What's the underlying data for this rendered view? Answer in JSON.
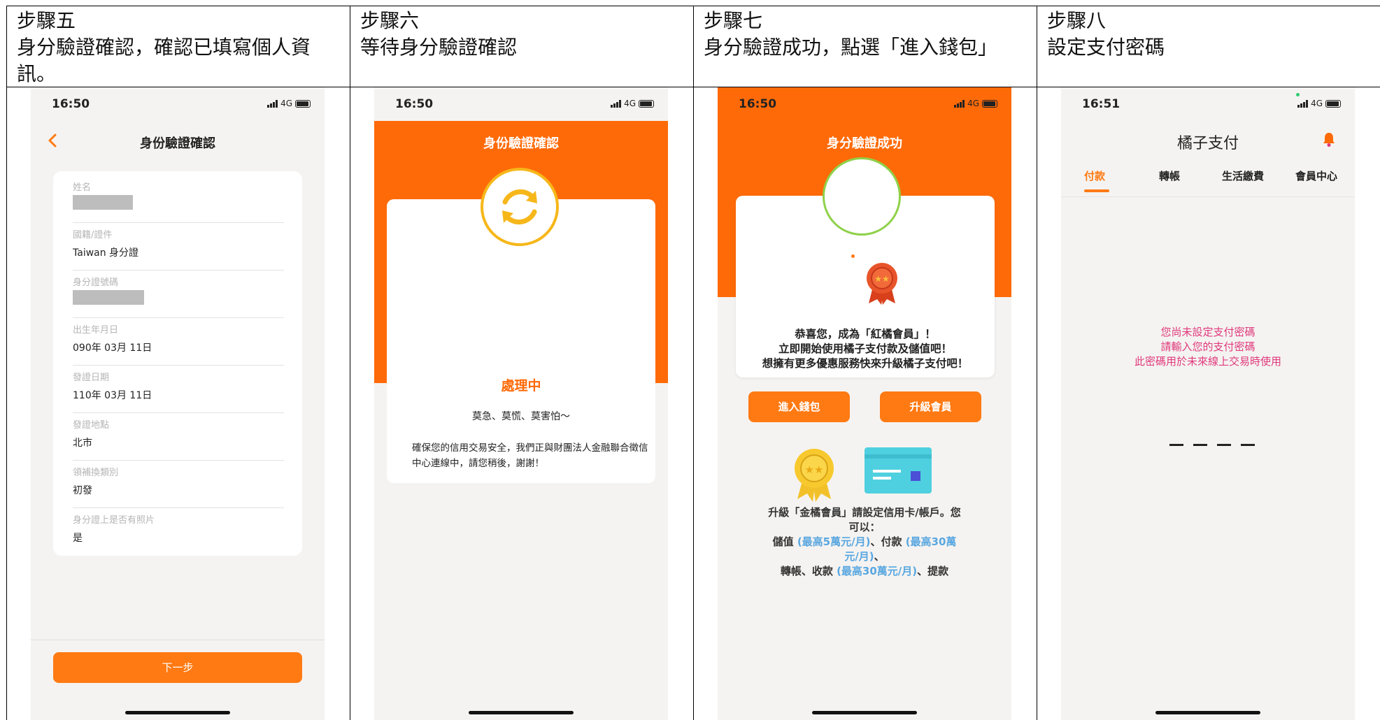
{
  "steps": [
    {
      "step": "步驟五",
      "lines": [
        "身分驗證確認，確認已填寫個人資",
        "訊。"
      ]
    },
    {
      "step": "步驟六",
      "lines": [
        "等待身分驗證確認"
      ]
    },
    {
      "step": "步驟七",
      "lines": [
        "身分驗證成功，點選「進入錢包」"
      ]
    },
    {
      "step": "步驟八",
      "lines": [
        "設定支付密碼"
      ]
    }
  ],
  "status": {
    "time1": "16:50",
    "time2": "16:50",
    "time3": "16:50",
    "time4": "16:51",
    "network": "4G"
  },
  "phone1": {
    "title": "身份驗證確認",
    "fields": [
      {
        "label": "姓名",
        "value": ""
      },
      {
        "label": "國籍/證件",
        "value": "Taiwan 身分證"
      },
      {
        "label": "身分證號碼",
        "value": ""
      },
      {
        "label": "出生年月日",
        "value": "090年 03月 11日"
      },
      {
        "label": "發證日期",
        "value": "110年 03月 11日"
      },
      {
        "label": "發證地點",
        "value": "北市"
      },
      {
        "label": "領補換類別",
        "value": "初發"
      },
      {
        "label": "身分證上是否有照片",
        "value": "是"
      }
    ],
    "next_button": "下一步"
  },
  "phone2": {
    "title": "身份驗證確認",
    "status_title": "處理中",
    "subtitle": "莫急、莫慌、莫害怕～",
    "description": "確保您的信用交易安全，我們正與財團法人金融聯合徵信中心連線中，請您稍後，謝謝！"
  },
  "phone3": {
    "title": "身分驗證成功",
    "congrats": [
      "恭喜您，成為「紅橘會員」！",
      "立即開始使用橘子支付款及儲值吧！",
      "想擁有更多優惠服務快來升級橘子支付吧！"
    ],
    "enter_wallet_button": "進入錢包",
    "upgrade_button": "升級會員",
    "upgrade_line1": "升級「金橘會員」請設定信用卡/帳戶。您",
    "upgrade_line2": "可以：",
    "upgrade_line3_a": "儲值 ",
    "upgrade_line3_b": "(最高5萬元/月)",
    "upgrade_line3_c": "、付款 ",
    "upgrade_line3_d": "(最高30萬",
    "upgrade_line4_a": "元/月)",
    "upgrade_line4_b": "、",
    "upgrade_line5_a": "轉帳、收款 ",
    "upgrade_line5_b": "(最高30萬元/月)",
    "upgrade_line5_c": "、提款"
  },
  "phone4": {
    "title": "橘子支付",
    "tabs": [
      "付款",
      "轉帳",
      "生活繳費",
      "會員中心"
    ],
    "message": [
      "您尚未設定支付密碼",
      "請輸入您的支付密碼",
      "此密碼用於未來線上交易時使用"
    ]
  },
  "colors": {
    "accent": "#ff6a08",
    "button": "#ff7a13",
    "pink": "#e0387b",
    "link_blue": "#59a7e0"
  }
}
